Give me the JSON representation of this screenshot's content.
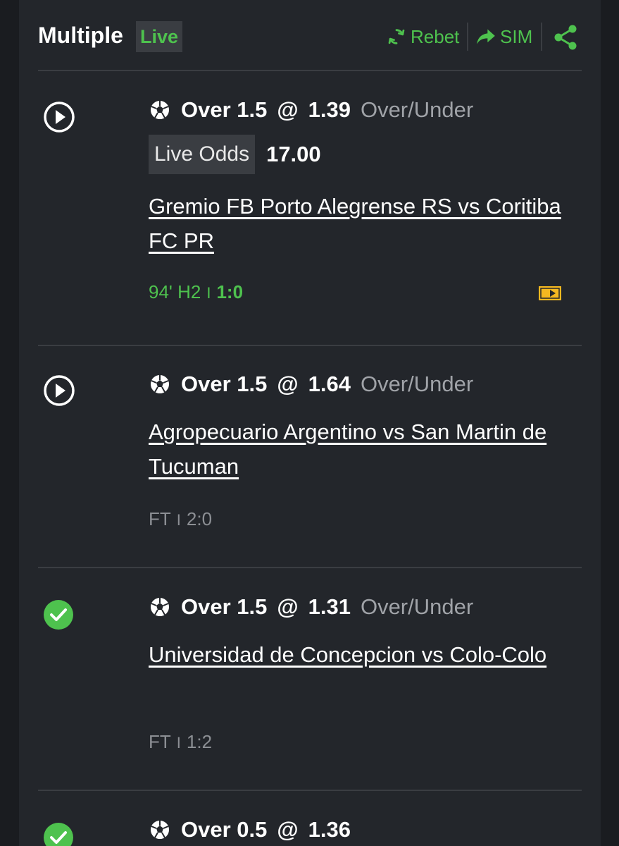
{
  "header": {
    "title": "Multiple",
    "badge": "Live",
    "actions": [
      {
        "label": "Rebet",
        "icon": "refresh-icon"
      },
      {
        "label": "SIM",
        "icon": "share-arrow-icon"
      },
      {
        "label": "",
        "icon": "share-icon"
      }
    ]
  },
  "bets": [
    {
      "status_icon": "play-icon",
      "selection": "Over 1.5",
      "at": "@",
      "odds": "1.39",
      "market": "Over/Under",
      "live_odds_label": "Live Odds",
      "live_odds_value": "17.00",
      "match": "Gremio FB Porto Alegrense RS vs Coritiba FC PR",
      "time": "94' H2",
      "separator": "I",
      "score": "1:0",
      "live": true
    },
    {
      "status_icon": "play-icon",
      "selection": "Over 1.5",
      "at": "@",
      "odds": "1.64",
      "market": "Over/Under",
      "match": "Agropecuario Argentino vs San Martin de Tucuman",
      "time": "FT",
      "separator": "I",
      "score": "2:0",
      "live": false
    },
    {
      "status_icon": "check-icon",
      "selection": "Over 1.5",
      "at": "@",
      "odds": "1.31",
      "market": "Over/Under",
      "match": "Universidad de Concepcion vs Colo-Colo",
      "time": "FT",
      "separator": "I",
      "score": "1:2",
      "live": false
    },
    {
      "status_icon": "check-icon",
      "selection": "Over 0.5",
      "at": "@",
      "odds": "1.36"
    }
  ],
  "colors": {
    "background": "#23262b",
    "accent_green": "#4ec24e",
    "muted_text": "#a0a3a8",
    "badge_bg": "#3a3d42",
    "tv_yellow": "#f5b820"
  }
}
